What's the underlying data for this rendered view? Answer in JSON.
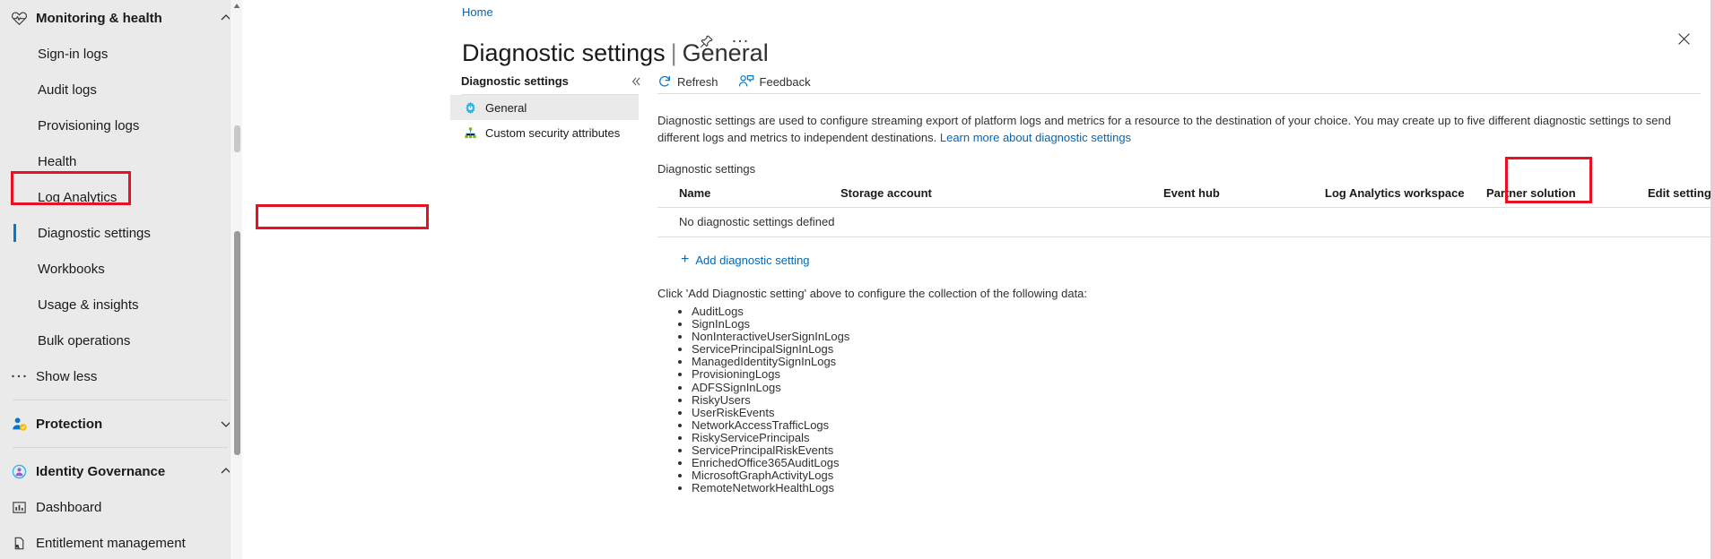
{
  "leftnav": {
    "items": [
      {
        "label": "Monitoring & health",
        "type": "group",
        "icon": "heart-pulse-icon",
        "chevron": "up"
      },
      {
        "label": "Sign-in logs",
        "type": "child"
      },
      {
        "label": "Audit logs",
        "type": "child"
      },
      {
        "label": "Provisioning logs",
        "type": "child"
      },
      {
        "label": "Health",
        "type": "child"
      },
      {
        "label": "Log Analytics",
        "type": "child"
      },
      {
        "label": "Diagnostic settings",
        "type": "child",
        "selected": true
      },
      {
        "label": "Workbooks",
        "type": "child"
      },
      {
        "label": "Usage & insights",
        "type": "child"
      },
      {
        "label": "Bulk operations",
        "type": "child"
      },
      {
        "label": "Show less",
        "type": "child-ico",
        "icon": "ellipsis-icon"
      },
      {
        "type": "separator"
      },
      {
        "label": "Protection",
        "type": "group",
        "icon": "user-shield-icon",
        "chevron": "down"
      },
      {
        "type": "separator"
      },
      {
        "label": "Identity Governance",
        "type": "group",
        "icon": "governance-icon",
        "chevron": "up"
      },
      {
        "label": "Dashboard",
        "type": "child-ico",
        "icon": "dashboard-icon"
      },
      {
        "label": "Entitlement management",
        "type": "child-ico",
        "icon": "document-icon"
      }
    ]
  },
  "header": {
    "breadcrumb": "Home",
    "title": "Diagnostic settings",
    "separator": "|",
    "subtitle": "General",
    "pin_icon": "pin-icon",
    "more_icon": "ellipsis-icon",
    "close_icon": "close-icon"
  },
  "inner_menu": {
    "header": "Diagnostic settings",
    "collapse_icon": "double-chevron-left-icon",
    "items": [
      {
        "label": "General",
        "icon": "gear-icon",
        "selected": true
      },
      {
        "label": "Custom security attributes",
        "icon": "sitemap-icon",
        "selected": false
      }
    ]
  },
  "toolbar": {
    "refresh_label": "Refresh",
    "refresh_icon": "refresh-icon",
    "feedback_label": "Feedback",
    "feedback_icon": "feedback-person-icon"
  },
  "main": {
    "description_part1": "Diagnostic settings are used to configure streaming export of platform logs and metrics for a resource to the destination of your choice. You may create up to five different diagnostic settings to send different logs and metrics to independent destinations. ",
    "description_link": "Learn more about diagnostic settings",
    "section_label": "Diagnostic settings",
    "table": {
      "columns": [
        "Name",
        "Storage account",
        "Event hub",
        "Log Analytics workspace",
        "Partner solution",
        "Edit setting"
      ],
      "empty_message": "No diagnostic settings defined"
    },
    "add_button_label": "Add diagnostic setting",
    "add_button_plus": "+",
    "click_note": "Click 'Add Diagnostic setting' above to configure the collection of the following data:",
    "log_types": [
      "AuditLogs",
      "SignInLogs",
      "NonInteractiveUserSignInLogs",
      "ServicePrincipalSignInLogs",
      "ManagedIdentitySignInLogs",
      "ProvisioningLogs",
      "ADFSSignInLogs",
      "RiskyUsers",
      "UserRiskEvents",
      "NetworkAccessTrafficLogs",
      "RiskyServicePrincipals",
      "ServicePrincipalRiskEvents",
      "EnrichedOffice365AuditLogs",
      "MicrosoftGraphActivityLogs",
      "RemoteNetworkHealthLogs"
    ]
  },
  "colors": {
    "accent": "#0078d4",
    "link": "#0067b8",
    "highlight": "#e81123",
    "nav_bg": "#eaeaea",
    "selected_bg": "#eaeaea"
  }
}
